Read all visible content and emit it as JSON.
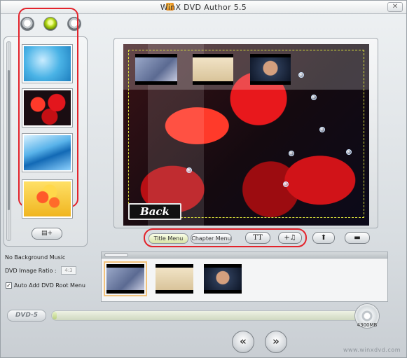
{
  "window": {
    "title": "WinX DVD Author 5.5",
    "close_glyph": "✕"
  },
  "toolbar": {
    "buttons": [
      "gray-circle",
      "green-circle",
      "gray-circle"
    ]
  },
  "left_panel": {
    "backgrounds": [
      "blue-water",
      "red-roses",
      "blue-waves",
      "yellow-flowers"
    ],
    "add_button_glyph": "▤+"
  },
  "preview": {
    "back_label": "Back"
  },
  "menu_tabs": {
    "title_menu": "Title Menu",
    "chapter_menu": "Chapter Menu"
  },
  "tools": {
    "text_glyph": "TT",
    "music_glyph": "+♫",
    "up_glyph": "⬆",
    "remove_glyph": "▬"
  },
  "options": {
    "background_music": "No Background Music",
    "aspect_ratio_label": "DVD Image Ratio :",
    "aspect_ratio_value": "4:3",
    "auto_root_menu_label": "Auto Add DVD Root Menu",
    "auto_root_menu_checked": true,
    "checkmark_glyph": "✓"
  },
  "timeline": {
    "clips": 3
  },
  "bottom": {
    "dvd_badge": "DVD-5",
    "disc_capacity": "4300MB",
    "progress_fraction": 0.01,
    "prev_glyph": "«",
    "next_glyph": "»",
    "watermark": "www.winxdvd.com"
  }
}
